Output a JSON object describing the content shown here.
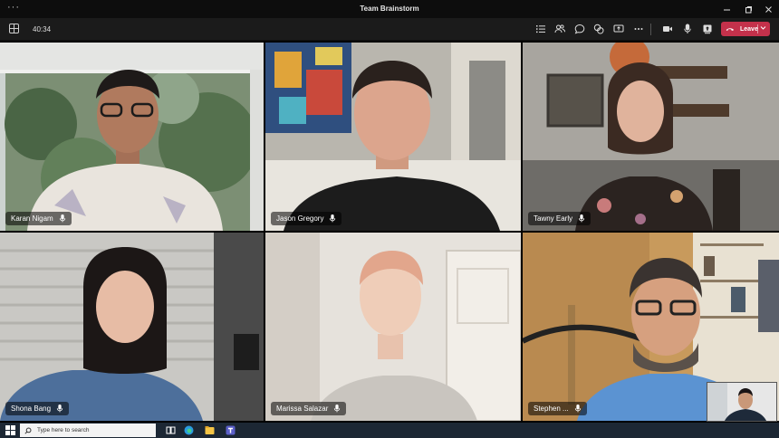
{
  "window": {
    "title": "Team Brainstorm",
    "menu_glyph": "···"
  },
  "toolbar": {
    "elapsed": "40:34",
    "leave_label": "Leave"
  },
  "participants": [
    {
      "name": "Karan Nigam"
    },
    {
      "name": "Jason Gregory"
    },
    {
      "name": "Tawny Early"
    },
    {
      "name": "Shona Bang"
    },
    {
      "name": "Marissa Salazar"
    },
    {
      "name": "Stephen ..."
    }
  ],
  "taskbar": {
    "search_placeholder": "Type here to search"
  },
  "colors": {
    "leave": "#c4314b",
    "toolbar": "#1b1b1b",
    "taskbar": "#1c2734"
  }
}
